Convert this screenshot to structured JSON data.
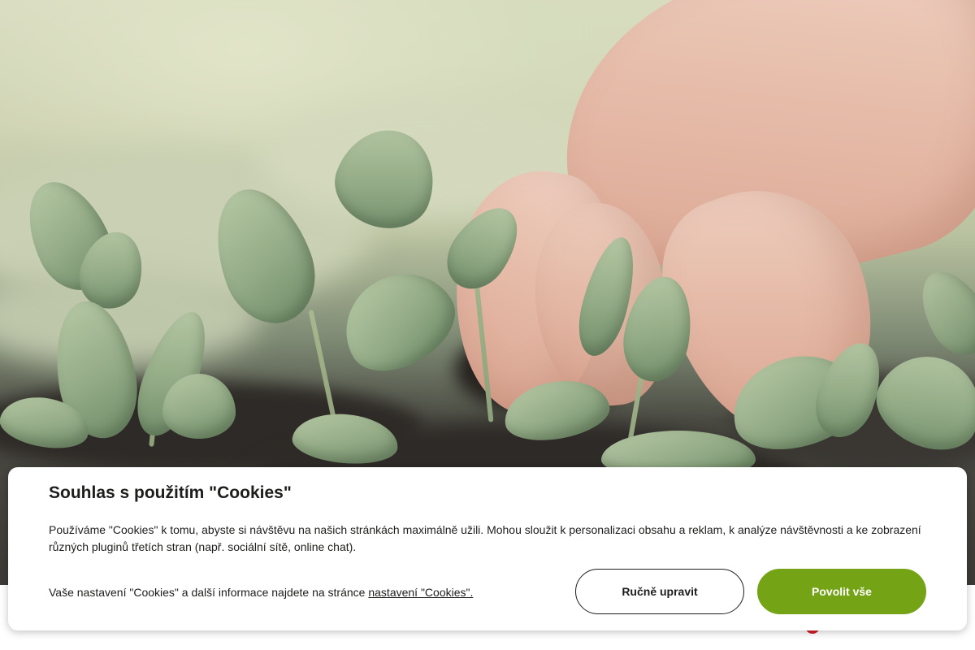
{
  "cookie_banner": {
    "title": "Souhlas s použitím \"Cookies\"",
    "description": "Používáme \"Cookies\" k tomu, abyste si návštěvu na našich stránkách maximálně užili. Mohou sloužit k personalizaci obsahu a reklam, k analýze návštěvnosti a ke zobrazení různých pluginů třetích stran (např. sociální sítě, online chat).",
    "settings_prefix": "Vaše nastavení \"Cookies\" a další informace najdete na stránce ",
    "settings_link": "nastavení \"Cookies\".",
    "manual_button": "Ručně upravit",
    "allow_all_button": "Povolit vše"
  },
  "colors": {
    "accent_green": "#75a316",
    "text": "#1d1d1b",
    "chat_bubble": "#d0202b"
  },
  "icons": {
    "chat": "chat-bubble-icon"
  }
}
